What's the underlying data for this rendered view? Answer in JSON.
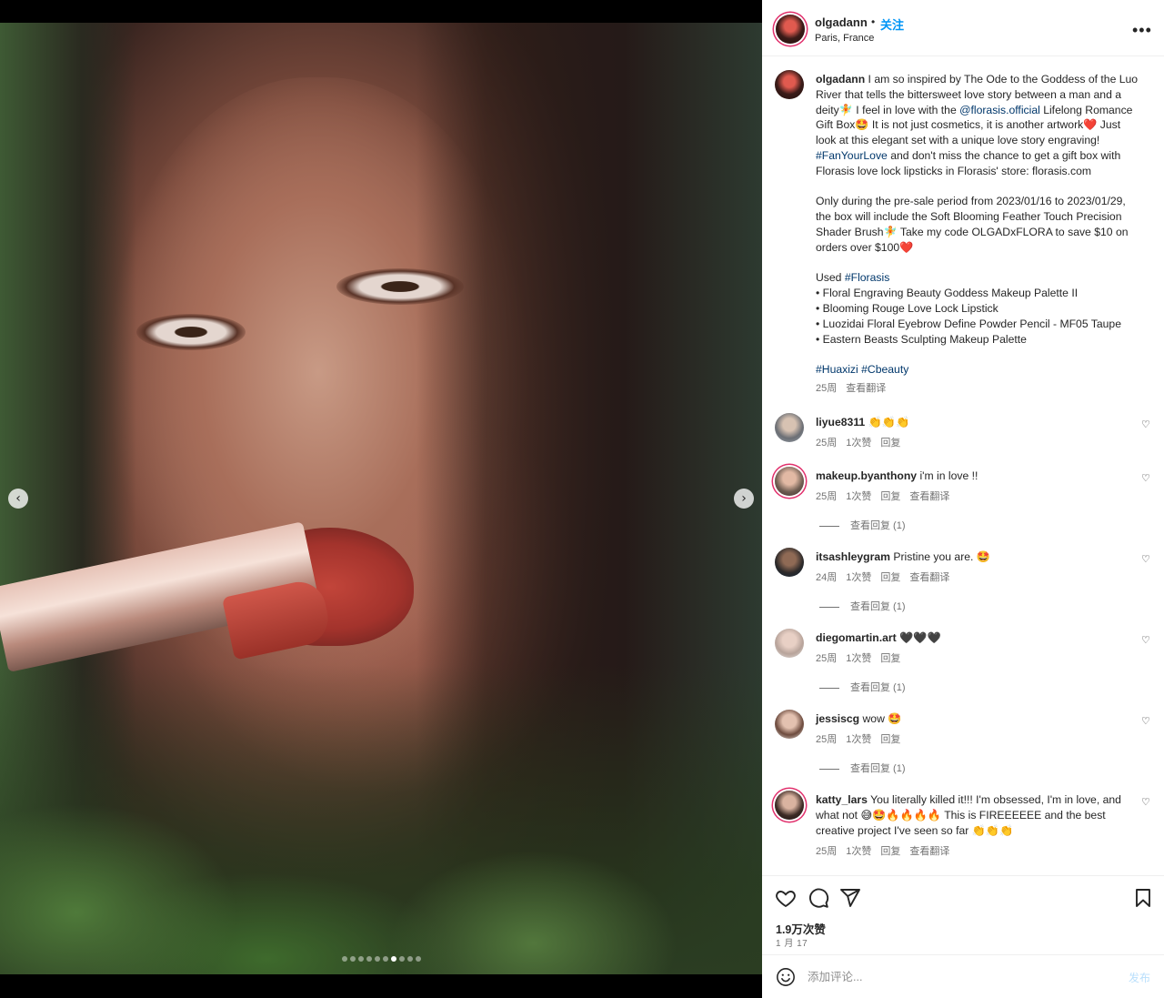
{
  "post": {
    "username": "olgadann",
    "follow_label": "关注",
    "separator": "•",
    "location": "Paris, France",
    "more_label": "•••"
  },
  "media": {
    "prev_label": "‹",
    "next_label": "›",
    "slide_count": 10,
    "active_slide": 7
  },
  "caption": {
    "username": "olgadann",
    "p1_a": " I am so inspired by The Ode to the Goddess of the Luo River that tells the bittersweet love story between a man and a deity🧚 I feel in love with the ",
    "p1_link": "@florasis.official",
    "p1_b": " Lifelong Romance Gift Box🤩 It is not just cosmetics, it is another artwork❤️ Just look at this elegant set with a unique love story engraving! ",
    "p1_tag": "#FanYourLove",
    "p1_c": " and don't miss the chance to get a gift box with Florasis love lock lipsticks in Florasis' store: florasis.com",
    "p2": "Only during the pre-sale period from 2023/01/16 to 2023/01/29, the box will include the Soft Blooming Feather Touch Precision Shader Brush🧚 Take my code OLGADxFLORA to save $10 on orders over $100❤️",
    "used_label": "Used ",
    "used_tag": "#Florasis",
    "items": [
      "• Floral Engraving Beauty Goddess Makeup Palette II",
      "• Blooming Rouge Love Lock Lipstick",
      "• Luozidai Floral Eyebrow Define Powder Pencil - MF05 Taupe",
      "• Eastern Beasts Sculpting Makeup Palette"
    ],
    "tags": [
      "#Huaxizi",
      "#Cbeauty"
    ],
    "time": "25周",
    "translate": "查看翻译"
  },
  "comments": [
    {
      "username": "liyue8311",
      "text": " 👏👏👏",
      "time": "25周",
      "likes": "1次赞",
      "reply": "回复",
      "translate": "",
      "replies": ""
    },
    {
      "username": "makeup.byanthony",
      "text": " i'm in love !!",
      "time": "25周",
      "likes": "1次赞",
      "reply": "回复",
      "translate": "查看翻译",
      "replies": "查看回复 (1)"
    },
    {
      "username": "itsashleygram",
      "text": " Pristine you are. 🤩",
      "time": "24周",
      "likes": "1次赞",
      "reply": "回复",
      "translate": "查看翻译",
      "replies": "查看回复 (1)"
    },
    {
      "username": "diegomartin.art",
      "text": " 🖤🖤🖤",
      "time": "25周",
      "likes": "1次赞",
      "reply": "回复",
      "translate": "",
      "replies": "查看回复 (1)"
    },
    {
      "username": "jessiscg",
      "text": " wow 🤩",
      "time": "25周",
      "likes": "1次赞",
      "reply": "回复",
      "translate": "",
      "replies": "查看回复 (1)"
    },
    {
      "username": "katty_lars",
      "text": " You literally killed it!!! I'm obsessed, I'm in love, and what not 😅🤩🔥🔥🔥🔥 This is FIREEEEEE and the best creative project I've seen so far 👏👏👏",
      "time": "25周",
      "likes": "1次赞",
      "reply": "回复",
      "translate": "查看翻译",
      "replies": ""
    }
  ],
  "actions": {
    "likes": "1.9万次赞",
    "date": "1 月 17"
  },
  "add_comment": {
    "placeholder": "添加评论...",
    "post_label": "发布"
  },
  "colors": {
    "accent": "#0095f6",
    "link": "#00376b",
    "muted": "#737373",
    "border": "#efefef"
  }
}
